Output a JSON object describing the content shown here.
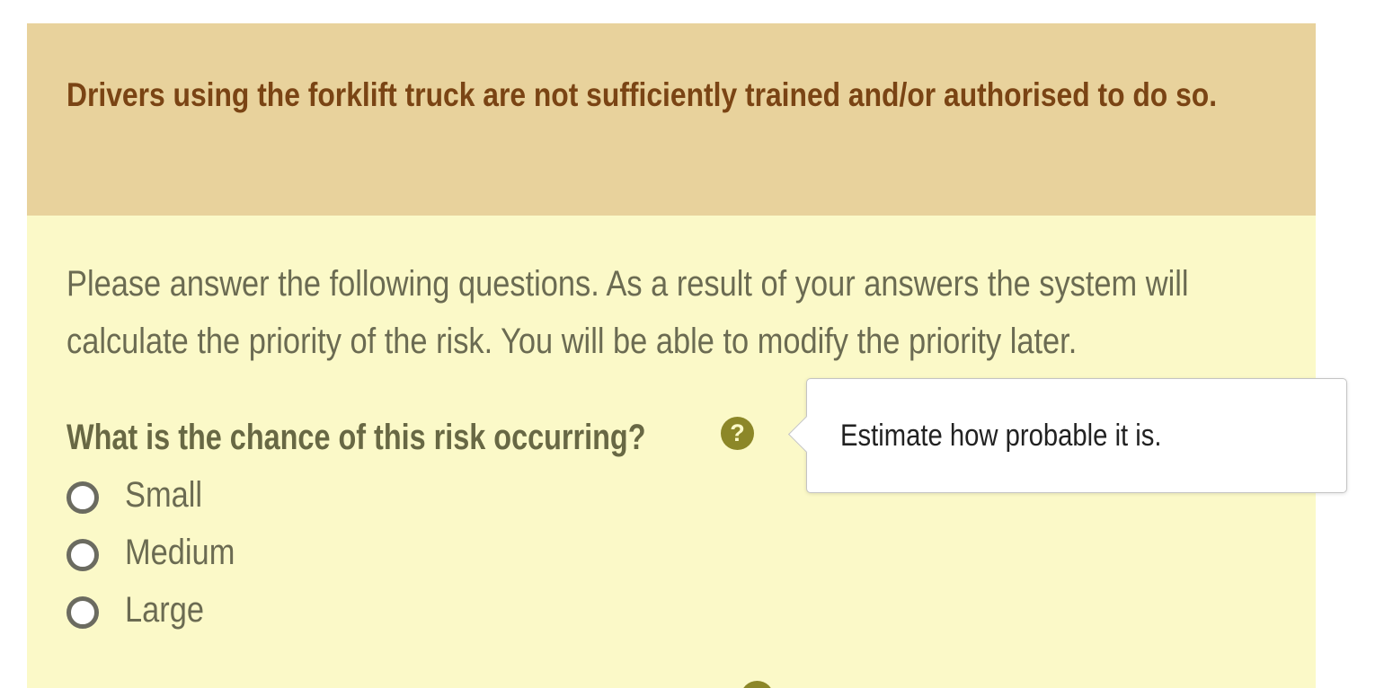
{
  "risk": {
    "title": "Drivers using the forklift truck are not sufficiently trained and/or authorised to do so."
  },
  "intro": "Please answer the following questions. As a result of your answers the system will calculate the priority of the risk. You will be able to modify the priority later.",
  "question": {
    "label": "What is the chance of this risk occurring?",
    "help_icon": "question-circle-icon",
    "help_glyph": "?",
    "options": [
      {
        "label": "Small",
        "selected": false
      },
      {
        "label": "Medium",
        "selected": false
      },
      {
        "label": "Large",
        "selected": false
      }
    ]
  },
  "tooltip": {
    "text": "Estimate how probable it is."
  },
  "colors": {
    "header_bg": "#e8d29c",
    "header_text": "#7a4414",
    "panel_bg": "#fbf9c8",
    "accent": "#8c8728"
  }
}
